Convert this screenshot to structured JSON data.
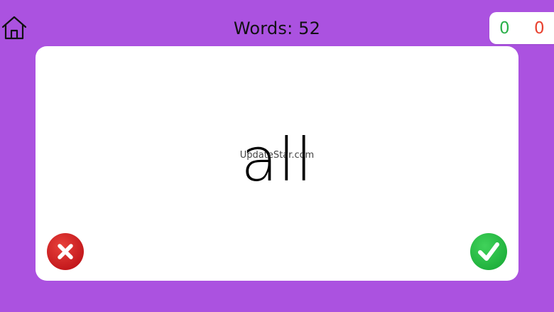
{
  "header": {
    "title": "Words: 52",
    "home_icon": "home-icon"
  },
  "score": {
    "correct": "0",
    "wrong": "0",
    "correct_color": "#2bb04a",
    "wrong_color": "#e8412f"
  },
  "card": {
    "word": "all",
    "watermark": "UpdateStar.com"
  },
  "buttons": {
    "wrong_icon": "close-icon",
    "right_icon": "checkmark-icon",
    "wrong_color": "#c2171b",
    "right_color": "#1fb03c"
  },
  "colors": {
    "background": "#ab52e0",
    "card": "#ffffff"
  }
}
